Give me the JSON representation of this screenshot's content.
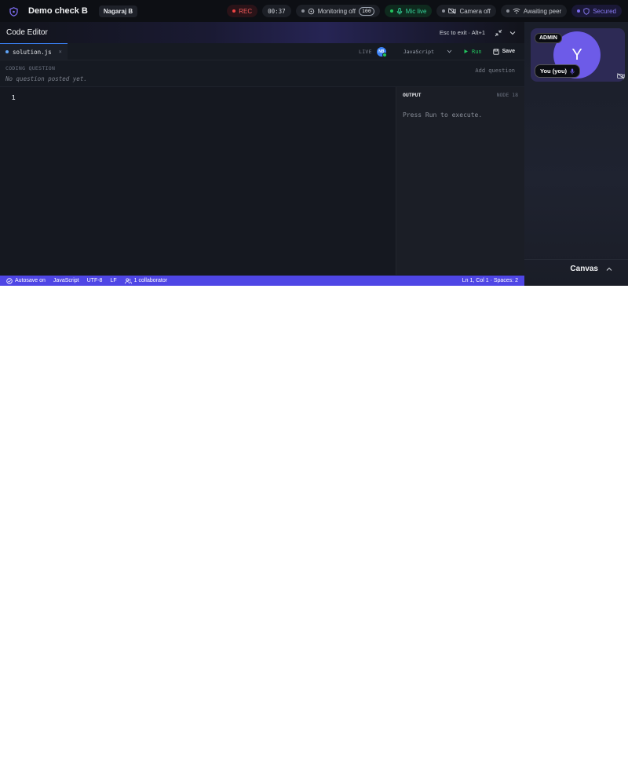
{
  "app": {
    "title": "Demo check B",
    "user": "Nagaraj B",
    "brand_icon": "shield-icon"
  },
  "status_pills": {
    "rec": "REC",
    "timer": "00:37",
    "monitoring": "Monitoring off",
    "monitoring_count": "100",
    "mic": "Mic live",
    "camera": "Camera off",
    "peer": "Awaiting peer",
    "secured": "Secured"
  },
  "editor": {
    "title": "Code Editor",
    "esc_hint": "Esc to exit · Alt+1",
    "tab_filename": "solution.js",
    "tab_close": "×",
    "live_label": "LIVE",
    "live_avatar": "NB",
    "language": "JavaScript",
    "run_label": "Run",
    "save_label": "Save",
    "question_label": "CODING QUESTION",
    "question_empty": "No question posted yet.",
    "add_question": "Add question",
    "line_number": "1",
    "output_title": "OUTPUT",
    "output_runtime": "NODE 18",
    "output_message": "Press Run to execute."
  },
  "statusbar": {
    "autosave": "Autosave on",
    "language": "JavaScript",
    "encoding": "UTF-8",
    "line_ending": "LF",
    "collaborators": "1 collaborator",
    "cursor": "Ln 1, Col 1 · Spaces: 2"
  },
  "participant": {
    "role_badge": "ADMIN",
    "initial": "Y",
    "name": "You (you)"
  },
  "canvas": {
    "label": "Canvas"
  },
  "colors": {
    "accent": "#4f46e5",
    "rec": "#ef4444",
    "mic_live": "#22c55e",
    "secured": "#7c6cf0",
    "avatar": "#6d5be8"
  }
}
